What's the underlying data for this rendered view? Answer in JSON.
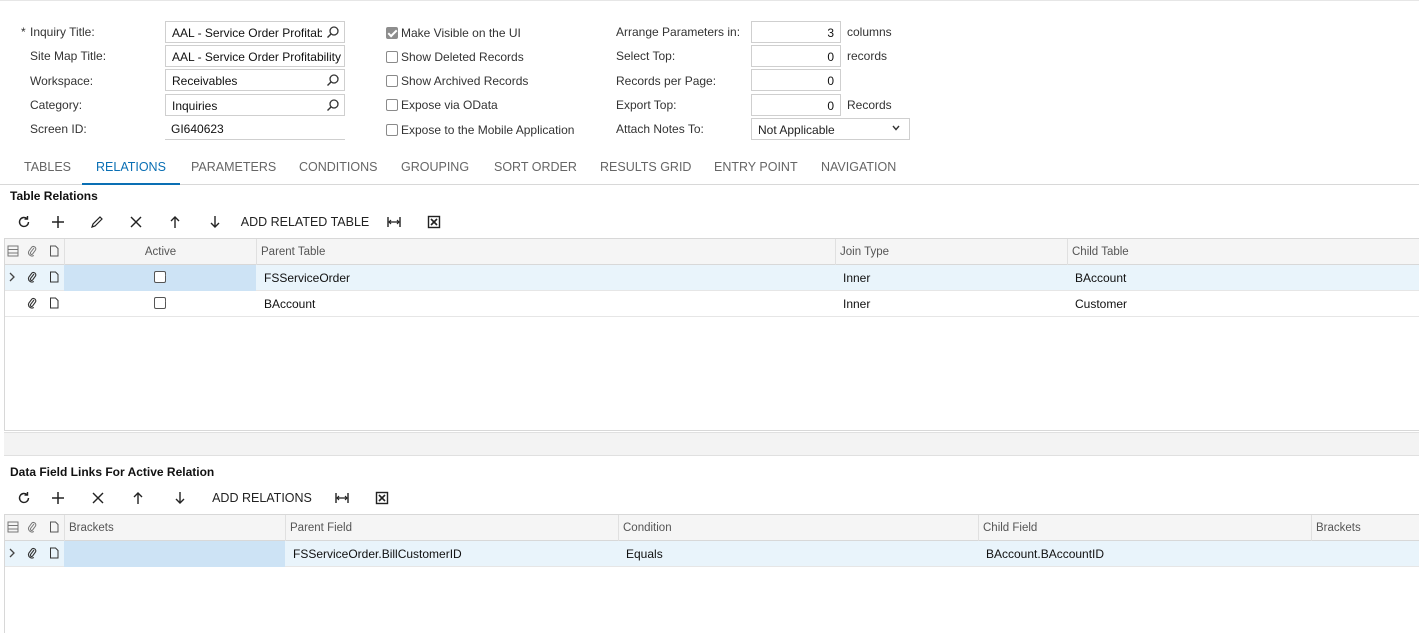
{
  "form": {
    "inquiry_title_label": "Inquiry Title:",
    "inquiry_title_value": "AAL - Service Order Profitabil",
    "site_map_title_label": "Site Map Title:",
    "site_map_title_value": "AAL - Service Order Profitability",
    "workspace_label": "Workspace:",
    "workspace_value": "Receivables",
    "category_label": "Category:",
    "category_value": "Inquiries",
    "screen_id_label": "Screen ID:",
    "screen_id_value": "GI640623",
    "required_mark": "*",
    "make_visible_label": "Make Visible on the UI",
    "make_visible_checked": true,
    "show_deleted_label": "Show Deleted Records",
    "show_archived_label": "Show Archived Records",
    "expose_odata_label": "Expose via OData",
    "expose_mobile_label": "Expose to the Mobile Application",
    "arrange_label": "Arrange Parameters in:",
    "arrange_value": "3",
    "arrange_unit": "columns",
    "select_top_label": "Select Top:",
    "select_top_value": "0",
    "select_top_unit": "records",
    "records_per_page_label": "Records per Page:",
    "records_per_page_value": "0",
    "export_top_label": "Export Top:",
    "export_top_value": "0",
    "export_top_unit": "Records",
    "attach_notes_label": "Attach Notes To:",
    "attach_notes_value": "Not Applicable"
  },
  "tabs": [
    "TABLES",
    "RELATIONS",
    "PARAMETERS",
    "CONDITIONS",
    "GROUPING",
    "SORT ORDER",
    "RESULTS GRID",
    "ENTRY POINT",
    "NAVIGATION"
  ],
  "active_tab": "RELATIONS",
  "relations": {
    "title": "Table Relations",
    "add_label": "ADD RELATED TABLE",
    "headers": {
      "active": "Active",
      "parent": "Parent Table",
      "join": "Join Type",
      "child": "Child Table"
    },
    "rows": [
      {
        "active": true,
        "parent": "FSServiceOrder",
        "join": "Inner",
        "child": "BAccount"
      },
      {
        "active": true,
        "parent": "BAccount",
        "join": "Inner",
        "child": "Customer"
      }
    ]
  },
  "links": {
    "title": "Data Field Links For Active Relation",
    "add_label": "ADD RELATIONS",
    "headers": {
      "brackets1": "Brackets",
      "parent": "Parent Field",
      "condition": "Condition",
      "child": "Child Field",
      "brackets2": "Brackets"
    },
    "rows": [
      {
        "brackets1": "",
        "parent": "FSServiceOrder.BillCustomerID",
        "condition": "Equals",
        "child": "BAccount.BAccountID",
        "brackets2": ""
      }
    ]
  },
  "colors": {
    "accent": "#0a6fb4",
    "selected_row": "#e9f4fb",
    "selected_cell": "#cde3f5"
  }
}
